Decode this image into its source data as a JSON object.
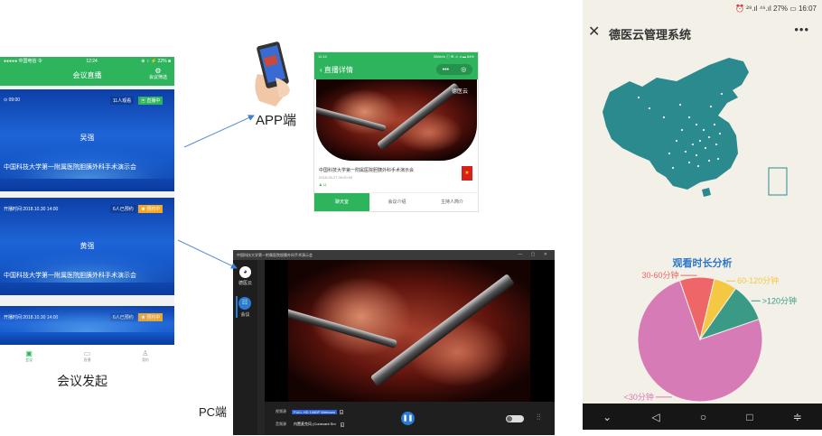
{
  "labels": {
    "app": "APP端",
    "meeting_launch": "会议发起",
    "pc": "PC端"
  },
  "left_phone": {
    "status": {
      "carrier": "●●●●● 中国电信 令",
      "time": "12:24",
      "battery": "⊕ ♀ ⚡ 22% ■"
    },
    "title": "会议直播",
    "title_icon_label": "会议筛选",
    "cards": [
      {
        "info": "⊙ 09:00",
        "count": "11人观看",
        "badge": "▣ 直播中",
        "badge_color": "#2fb45e",
        "host": "吴强",
        "title": "中国科技大学第一附属医院胆胰外科手术演示会"
      },
      {
        "info": "开播时间:2018.10.30 14:00",
        "count": "6人已预约",
        "badge": "★ 预约中",
        "badge_color": "#f5a623",
        "host": "黄强",
        "title": "中国科技大学第一附属医院胆胰外科手术演示会"
      },
      {
        "info": "开播时间:2018.10.30 14:00",
        "count": "6人已预约",
        "badge": "★ 预约中",
        "badge_color": "#f5a623",
        "host": "",
        "title": ""
      }
    ],
    "tabs": [
      {
        "icon": "▣",
        "label": "会议",
        "active": true
      },
      {
        "icon": "▭",
        "label": "直播",
        "active": false
      },
      {
        "icon": "♙",
        "label": "我的",
        "active": false
      }
    ]
  },
  "detail": {
    "status": {
      "time": "11:14",
      "right": "26/kb/s ⓘ ✉ .ıl .ıl ▬ 84%"
    },
    "title": "‹  直播详情",
    "capsule": {
      "more": "•••",
      "target": "◎"
    },
    "watermark": "德医云",
    "caption": "中国科技大学第一附属医院胆胰外科手术演示会",
    "date": "2018-05-27 09:00:00",
    "likes": "♟ 11",
    "flag": "★",
    "tabs": [
      {
        "label": "聊天室",
        "active": true
      },
      {
        "label": "会议介绍",
        "active": false
      },
      {
        "label": "主持人简介",
        "active": false
      }
    ]
  },
  "pc": {
    "window_title": "中国科技大学第一附属医院胆胰外科手术演示会",
    "window_buttons": "— ▢ ✕",
    "logo_text": "德医云",
    "logo_icon": "◕",
    "meeting_label": "会议",
    "meeting_icon": "☷",
    "video_source_label": "视频源",
    "video_source_value": "FULL HD 1080P Webcam",
    "audio_source_label": "音频源",
    "audio_source_value": "内置麦克风 (Conexant Sm",
    "play_icon": "❚❚",
    "eq_icon": "⫶⫶"
  },
  "right_phone": {
    "status": "⏰ ²⁸.ıl ⁴⁶.ıl 27% ▭ 16:07",
    "close_icon": "✕",
    "title": "德医云管理系统",
    "more_icon": "•••",
    "analysis_title": "观看时长分析",
    "nav": {
      "down": "⌄",
      "back": "◁",
      "home": "○",
      "recent": "□",
      "menu": "≑"
    },
    "map_colors": {
      "land": "#2a8a8e",
      "dots": "#f3f0e8"
    }
  },
  "chart_data": {
    "type": "pie",
    "title": "观看时长分析",
    "categories": [
      "<30分钟",
      "30-60分钟",
      "60-120分钟",
      ">120分钟"
    ],
    "values": [
      75,
      9,
      6,
      10
    ],
    "colors": [
      "#d77bb6",
      "#ee6667",
      "#f4c842",
      "#3a9a86"
    ]
  }
}
